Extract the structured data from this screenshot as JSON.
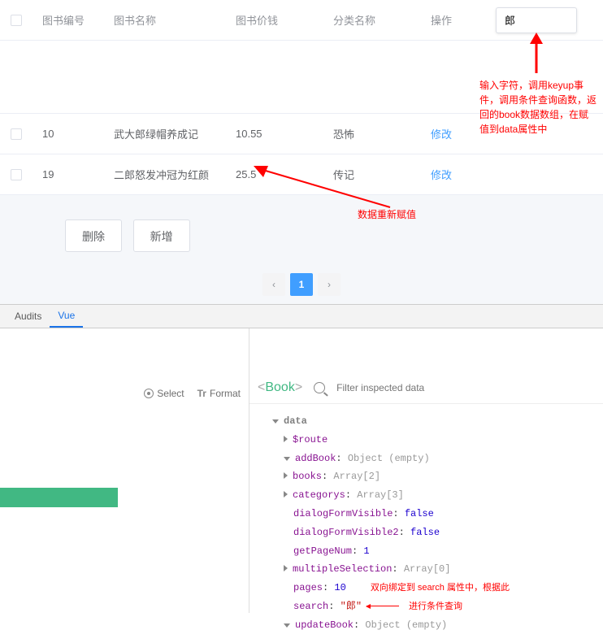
{
  "table": {
    "headers": {
      "id": "图书编号",
      "name": "图书名称",
      "price": "图书价钱",
      "category": "分类名称",
      "op": "操作"
    },
    "rows": [
      {
        "id": "10",
        "name": "武大郎绿帽养成记",
        "price": "10.55",
        "category": "恐怖",
        "op": "修改"
      },
      {
        "id": "19",
        "name": "二郎怒发冲冠为红颜",
        "price": "25.5",
        "category": "传记",
        "op": "修改"
      }
    ],
    "search_value": "郎"
  },
  "buttons": {
    "delete": "删除",
    "add": "新增"
  },
  "pagination": {
    "prev": "‹",
    "page": "1",
    "next": "›"
  },
  "annotations": {
    "search_note": "输入字符，调用keyup事件，调用条件查询函数，返回的book数据数组，在赋值到data属性中",
    "reassign": "数据重新赋值",
    "bind_note_1": "双向绑定到 search 属性中，根据此",
    "bind_note_2": "进行条件查询"
  },
  "devtools": {
    "tabs": {
      "audits": "Audits",
      "vue": "Vue"
    },
    "toolbar": {
      "select": "Select",
      "format": "Format"
    },
    "component": "Book",
    "filter_placeholder": "Filter inspected data",
    "data_section": "data",
    "props": {
      "route": "$route",
      "addBook": {
        "k": "addBook",
        "v": "Object (empty)"
      },
      "books": {
        "k": "books",
        "v": "Array[2]"
      },
      "categorys": {
        "k": "categorys",
        "v": "Array[3]"
      },
      "dfv": {
        "k": "dialogFormVisible",
        "v": "false"
      },
      "dfv2": {
        "k": "dialogFormVisible2",
        "v": "false"
      },
      "getPageNum": {
        "k": "getPageNum",
        "v": "1"
      },
      "multipleSelection": {
        "k": "multipleSelection",
        "v": "Array[0]"
      },
      "pages": {
        "k": "pages",
        "v": "10"
      },
      "search": {
        "k": "search",
        "v": "\"郎\""
      },
      "updateBook": {
        "k": "updateBook",
        "v": "Object (empty)"
      }
    }
  }
}
